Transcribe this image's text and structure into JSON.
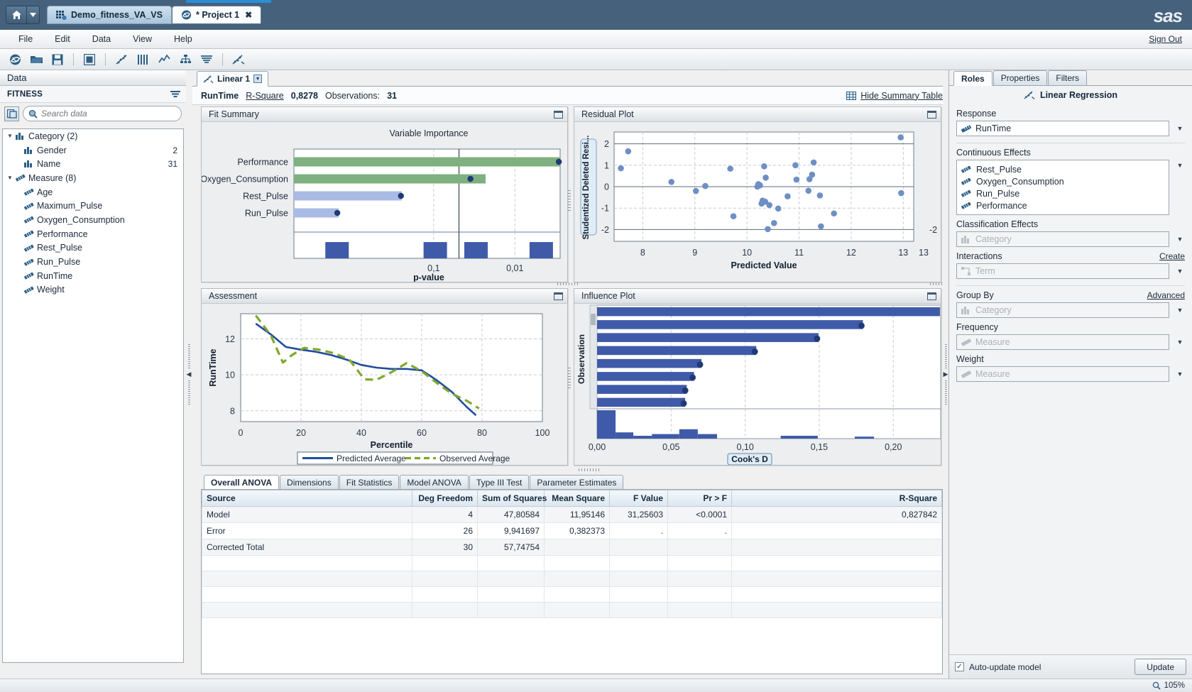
{
  "titlebar": {
    "home_icon": "home-icon",
    "home_caret_icon": "chevron-down-icon",
    "tabs": [
      {
        "label": "Demo_fitness_VA_VS",
        "icon": "data-grid-icon",
        "active": false,
        "closable": false
      },
      {
        "label": "* Project 1",
        "icon": "sas-swirl-icon",
        "active": true,
        "closable": true,
        "close_label": "✖"
      }
    ],
    "brand": "sas"
  },
  "menubar": {
    "items": [
      "File",
      "Edit",
      "Data",
      "View",
      "Help"
    ],
    "signout": "Sign Out"
  },
  "toolbar": {
    "buttons": [
      "sas-swirl-icon",
      "open-folder-icon",
      "save-icon",
      "layout-icon",
      "scatter-plot-icon",
      "bar-chart-icon",
      "line-chart-icon",
      "decision-tree-icon",
      "forecast-icon",
      "regression-icon"
    ]
  },
  "left_panel": {
    "title": "Data",
    "dataset_name": "FITNESS",
    "dataset_menu_icon": "filter-menu-icon",
    "source_icon": "data-source-icon",
    "search": {
      "placeholder": "Search data",
      "value": "",
      "icon": "search-icon"
    },
    "tree": [
      {
        "label": "Category (2)",
        "count": "",
        "level": 0,
        "icon": "category-icon",
        "expanded": true
      },
      {
        "label": "Gender",
        "count": "2",
        "level": 1,
        "icon": "category-icon"
      },
      {
        "label": "Name",
        "count": "31",
        "level": 1,
        "icon": "category-icon"
      },
      {
        "label": "Measure (8)",
        "count": "",
        "level": 0,
        "icon": "measure-icon",
        "expanded": true
      },
      {
        "label": "Age",
        "count": "",
        "level": 1,
        "icon": "measure-icon"
      },
      {
        "label": "Maximum_Pulse",
        "count": "",
        "level": 1,
        "icon": "measure-icon"
      },
      {
        "label": "Oxygen_Consumption",
        "count": "",
        "level": 1,
        "icon": "measure-icon"
      },
      {
        "label": "Performance",
        "count": "",
        "level": 1,
        "icon": "measure-icon"
      },
      {
        "label": "Rest_Pulse",
        "count": "",
        "level": 1,
        "icon": "measure-icon"
      },
      {
        "label": "Run_Pulse",
        "count": "",
        "level": 1,
        "icon": "measure-icon"
      },
      {
        "label": "RunTime",
        "count": "",
        "level": 1,
        "icon": "measure-icon"
      },
      {
        "label": "Weight",
        "count": "",
        "level": 1,
        "icon": "measure-icon"
      }
    ]
  },
  "center": {
    "object_tab": {
      "label": "Linear 1",
      "icon": "regression-icon",
      "menu_icon": "chevron-down-icon"
    },
    "summary": {
      "response": "RunTime",
      "rsquare_label": "R-Square",
      "rsquare_value": "0,8278",
      "observations_label": "Observations:",
      "observations_value": "31",
      "hide_summary": "Hide Summary Table",
      "hide_summary_icon": "table-icon"
    },
    "cards": {
      "fit_summary": {
        "title": "Fit Summary",
        "maximize_icon": "maximize-icon"
      },
      "residual_plot": {
        "title": "Residual Plot",
        "maximize_icon": "maximize-icon"
      },
      "assessment": {
        "title": "Assessment",
        "maximize_icon": "maximize-icon"
      },
      "influence_plot": {
        "title": "Influence Plot",
        "maximize_icon": "maximize-icon"
      }
    },
    "data_tabs": [
      {
        "label": "Overall ANOVA",
        "active": true
      },
      {
        "label": "Dimensions",
        "active": false
      },
      {
        "label": "Fit Statistics",
        "active": false
      },
      {
        "label": "Model ANOVA",
        "active": false
      },
      {
        "label": "Type III Test",
        "active": false
      },
      {
        "label": "Parameter Estimates",
        "active": false
      }
    ],
    "anova_table": {
      "columns": [
        "Source",
        "Deg Freedom",
        "Sum of Squares",
        "Mean Square",
        "F Value",
        "Pr > F",
        "R-Square"
      ],
      "rows": [
        [
          "Model",
          "4",
          "47,80584",
          "11,95146",
          "31,25603",
          "<0.0001",
          "0,827842"
        ],
        [
          "Error",
          "26",
          "9,941697",
          "0,382373",
          ".",
          ".",
          ""
        ],
        [
          "Corrected Total",
          "30",
          "57,74754",
          "",
          "",
          "",
          ""
        ]
      ],
      "empty_rows": 4
    }
  },
  "right_panel": {
    "tabs": [
      {
        "label": "Roles",
        "active": true
      },
      {
        "label": "Properties",
        "active": false
      },
      {
        "label": "Filters",
        "active": false
      }
    ],
    "title": "Linear Regression",
    "title_icon": "regression-icon",
    "sections": {
      "response": {
        "label": "Response",
        "value": "RunTime",
        "icon": "measure-icon",
        "caret": "chevron-down-icon"
      },
      "continuous_effects": {
        "label": "Continuous Effects",
        "items": [
          "Rest_Pulse",
          "Oxygen_Consumption",
          "Run_Pulse",
          "Performance"
        ],
        "icon": "measure-icon",
        "caret": "chevron-down-icon"
      },
      "classification_effects": {
        "label": "Classification Effects",
        "placeholder": "Category",
        "icon": "category-icon",
        "caret": "chevron-down-icon"
      },
      "interactions": {
        "label": "Interactions",
        "link": "Create",
        "placeholder": "Term",
        "icon": "interaction-icon",
        "caret": "chevron-down-icon"
      },
      "group_by": {
        "label": "Group By",
        "link": "Advanced",
        "placeholder": "Category",
        "icon": "category-icon",
        "caret": "chevron-down-icon"
      },
      "frequency": {
        "label": "Frequency",
        "placeholder": "Measure",
        "icon": "measure-icon",
        "caret": "chevron-down-icon"
      },
      "weight": {
        "label": "Weight",
        "placeholder": "Measure",
        "icon": "measure-icon",
        "caret": "chevron-down-icon"
      }
    },
    "footer": {
      "auto_update_label": "Auto-update model",
      "auto_update_checked": true,
      "update_button": "Update"
    }
  },
  "statusbar": {
    "zoom": "105%",
    "zoom_icon": "zoom-icon"
  },
  "colors": {
    "accent_blue": "#3b5aa6",
    "bar_green": "#7fb07f",
    "bar_lightblue": "#a9bbe4",
    "dot_navy": "#1f3a75",
    "scatter_blue": "#6e8fc4",
    "line_blue": "#1f4c9e",
    "line_green": "#7fa82a",
    "titlebar": "#46617c"
  },
  "chart_data": [
    {
      "id": "fit_summary",
      "type": "bar",
      "title": "Variable Importance",
      "xlabel": "p-value",
      "ylabel": "",
      "categories": [
        "Performance",
        "Oxygen_Consumption",
        "Rest_Pulse",
        "Run_Pulse"
      ],
      "bar_fraction": [
        1.0,
        0.72,
        0.405,
        0.168
      ],
      "bar_colors": [
        "#7fb07f",
        "#7fb07f",
        "#a9bbe4",
        "#a9bbe4"
      ],
      "marker_fraction": [
        0.995,
        0.663,
        0.402,
        0.163
      ],
      "xticks": [
        {
          "label": "0,1",
          "pos": 0.525
        },
        {
          "label": "0,01",
          "pos": 0.83
        }
      ],
      "reference_line_pos": 0.62,
      "grid": true,
      "histogram_bars": [
        {
          "pos": 0.118,
          "width": 0.088,
          "height": 0.62
        },
        {
          "pos": 0.487,
          "width": 0.088,
          "height": 0.62
        },
        {
          "pos": 0.64,
          "width": 0.088,
          "height": 0.62
        },
        {
          "pos": 0.885,
          "width": 0.088,
          "height": 0.62
        }
      ]
    },
    {
      "id": "residual_plot",
      "type": "scatter",
      "title": "",
      "xlabel": "Predicted Value",
      "ylabel": "Studentized Deleted Resi...",
      "xticks": [
        "8",
        "9",
        "10",
        "11",
        "12",
        "13"
      ],
      "yticks": [
        "2",
        "1",
        "0",
        "-1",
        "-2"
      ],
      "xlim": [
        7.45,
        13.2
      ],
      "ylim": [
        -2.55,
        2.55
      ],
      "grid": true,
      "points": [
        [
          7.72,
          1.65
        ],
        [
          7.58,
          0.86
        ],
        [
          8.55,
          0.22
        ],
        [
          9.02,
          -0.2
        ],
        [
          9.2,
          0.03
        ],
        [
          9.68,
          0.84
        ],
        [
          9.74,
          -1.38
        ],
        [
          10.22,
          0.12
        ],
        [
          10.2,
          0.0
        ],
        [
          10.33,
          0.95
        ],
        [
          10.36,
          0.42
        ],
        [
          10.3,
          -0.65
        ],
        [
          10.28,
          -0.79
        ],
        [
          10.43,
          -0.86
        ],
        [
          10.6,
          -1.02
        ],
        [
          10.4,
          -1.98
        ],
        [
          10.52,
          -1.7
        ],
        [
          10.78,
          -0.45
        ],
        [
          10.93,
          1.0
        ],
        [
          10.95,
          0.33
        ],
        [
          11.2,
          0.35
        ],
        [
          11.28,
          1.13
        ],
        [
          11.25,
          0.56
        ],
        [
          11.18,
          -0.19
        ],
        [
          11.4,
          -0.41
        ],
        [
          11.42,
          -1.85
        ],
        [
          11.67,
          -1.25
        ],
        [
          12.95,
          2.3
        ],
        [
          12.96,
          -0.3
        ],
        [
          10.25,
          0.06
        ],
        [
          10.35,
          -0.7
        ]
      ]
    },
    {
      "id": "assessment",
      "type": "line",
      "title": "",
      "xlabel": "Percentile",
      "ylabel": "RunTime",
      "xticks": [
        "0",
        "20",
        "40",
        "60",
        "80",
        "100"
      ],
      "yticks": [
        "12",
        "10",
        "8"
      ],
      "xlim": [
        0,
        100
      ],
      "ylim": [
        7.4,
        13.4
      ],
      "grid": true,
      "legend": [
        {
          "name": "Predicted Average",
          "color": "#1f4c9e",
          "style": "solid"
        },
        {
          "name": "Observed Average",
          "color": "#7fa82a",
          "style": "dashed"
        }
      ],
      "series": [
        {
          "name": "Predicted Average",
          "color": "#1f4c9e",
          "style": "solid",
          "x": [
            5,
            10,
            15,
            20,
            25,
            30,
            35,
            40,
            45,
            50,
            55,
            60,
            65,
            70,
            75,
            78
          ],
          "y": [
            12.85,
            12.25,
            11.55,
            11.4,
            11.28,
            11.1,
            10.85,
            10.55,
            10.4,
            10.33,
            10.33,
            10.25,
            9.7,
            9.05,
            8.2,
            7.75
          ]
        },
        {
          "name": "Observed Average",
          "color": "#7fa82a",
          "style": "dashed",
          "x": [
            5,
            10,
            14,
            17,
            21,
            26,
            31,
            36,
            41,
            45,
            50,
            55,
            60,
            65,
            70,
            75,
            79
          ],
          "y": [
            13.3,
            12.2,
            10.68,
            11.1,
            11.5,
            11.4,
            11.2,
            10.85,
            9.75,
            9.72,
            10.15,
            10.65,
            10.2,
            9.55,
            8.95,
            8.55,
            8.13
          ]
        }
      ]
    },
    {
      "id": "influence_plot",
      "type": "bar",
      "title": "",
      "xlabel": "Cook's D",
      "ylabel": "Observation",
      "xticks": [
        "0,00",
        "0,05",
        "0,10",
        "0,15",
        "0,20"
      ],
      "xlim": [
        0,
        0.232
      ],
      "grid": true,
      "bars": [
        0.2315,
        0.1795,
        0.1495,
        0.1075,
        0.0705,
        0.0655,
        0.0605,
        0.0595
      ],
      "histogram_bars": [
        {
          "x0": 0.0,
          "x1": 0.0125,
          "h": 1.0
        },
        {
          "x0": 0.0125,
          "x1": 0.0245,
          "h": 0.22
        },
        {
          "x0": 0.0245,
          "x1": 0.037,
          "h": 0.1
        },
        {
          "x0": 0.037,
          "x1": 0.0555,
          "h": 0.16
        },
        {
          "x0": 0.0555,
          "x1": 0.068,
          "h": 0.33
        },
        {
          "x0": 0.068,
          "x1": 0.081,
          "h": 0.16
        },
        {
          "x0": 0.124,
          "x1": 0.149,
          "h": 0.1
        },
        {
          "x0": 0.174,
          "x1": 0.187,
          "h": 0.07
        }
      ]
    }
  ]
}
